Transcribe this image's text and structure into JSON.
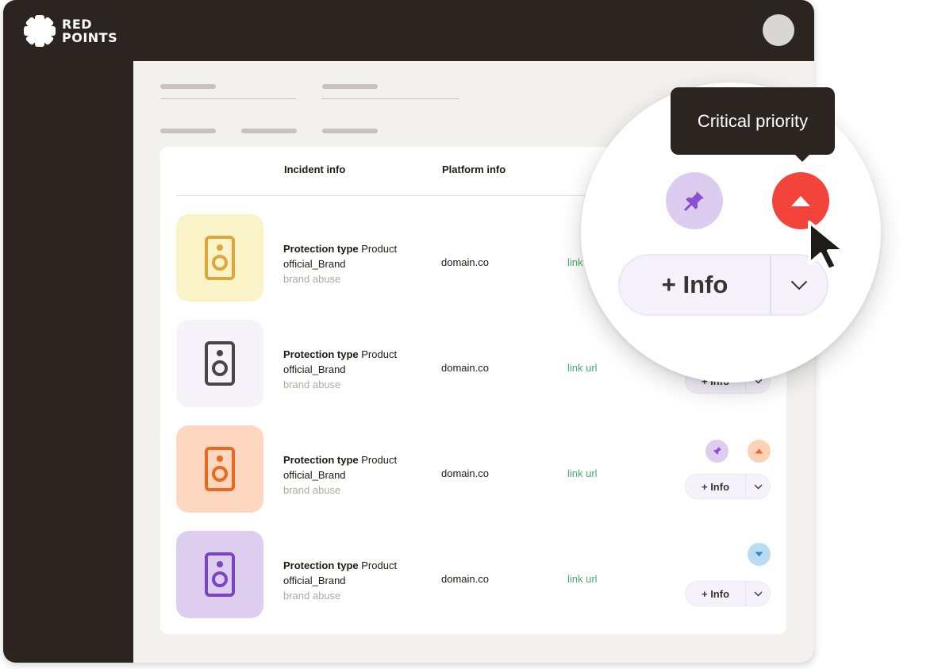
{
  "brand": {
    "line1": "RED",
    "line2": "POINTS"
  },
  "table": {
    "headers": {
      "incident": "Incident info",
      "platform": "Platform info"
    },
    "rows": [
      {
        "label": "Protection type",
        "value": "Product",
        "brand": "official_Brand",
        "category": "brand abuse",
        "platform": "domain.co",
        "link": "link url",
        "thumb_bg": "#faf3c8",
        "icon_color": "#e0a63a"
      },
      {
        "label": "Protection type",
        "value": "Product",
        "brand": "official_Brand",
        "category": "brand abuse",
        "platform": "domain.co",
        "link": "link url",
        "thumb_bg": "#f6f3fb",
        "icon_color": "#4a4547",
        "action": "+ Info"
      },
      {
        "label": "Protection type",
        "value": "Product",
        "brand": "official_Brand",
        "category": "brand abuse",
        "platform": "domain.co",
        "link": "link url",
        "thumb_bg": "#fdd7c0",
        "icon_color": "#e86a1f",
        "action": "+ Info",
        "priority": "high"
      },
      {
        "label": "Protection type",
        "value": "Product",
        "brand": "official_Brand",
        "category": "brand abuse",
        "platform": "domain.co",
        "link": "link url",
        "thumb_bg": "#ddcdee",
        "icon_color": "#7a45c0",
        "action": "+ Info",
        "priority": "low"
      }
    ]
  },
  "zoom": {
    "tooltip": "Critical priority",
    "action": "+ Info",
    "priority": "critical"
  },
  "colors": {
    "accent_critical": "#f2443a",
    "accent_high": "#fbd2b6",
    "accent_low": "#b9dcf2",
    "pin": "#8a4fd2",
    "link": "#4aaa6a"
  }
}
